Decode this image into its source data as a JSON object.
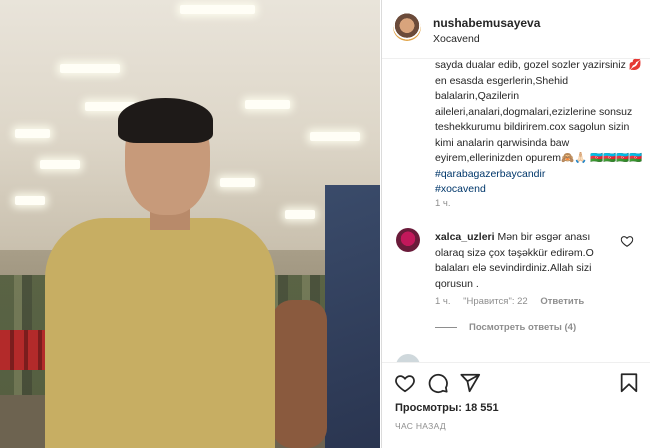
{
  "post": {
    "username": "nushabemusayeva",
    "location": "Xocavend"
  },
  "caption": {
    "text": "sayda dualar edib, gozel sozler yazirsiniz 💋en esasda esgerlerin,Shehid balalarin,Qazilerin aileleri,analari,dogmalari,ezizlerine sonsuz teshekkurumu bildirirem.cox sagolun sizin kimi analarin qarwisinda baw eyirem,ellerinizden opurem🙈🙏🏻 🇦🇿🇦🇿🇦🇿🇦🇿 ",
    "tag1": "#qarabagazerbaycandir",
    "tag2": "#xocavend",
    "time": "1 ч."
  },
  "comment": {
    "user": "xalca_uzleri",
    "text": "Mən bir əsgər anası olaraq sizə çox təşəkkür edirəm.O balaları elə sevindirdiniz.Allah sizi qorusun .",
    "time": "1 ч.",
    "likes": "\"Нравится\": 22",
    "reply_label": "Ответить",
    "view_replies": "Посмотреть ответы (4)"
  },
  "footer": {
    "views": "Просмотры: 18 551",
    "ago": "ЧАС НАЗАД"
  },
  "icons": {
    "like": "heart-icon",
    "comment": "comment-icon",
    "share": "share-icon",
    "save": "bookmark-icon"
  }
}
